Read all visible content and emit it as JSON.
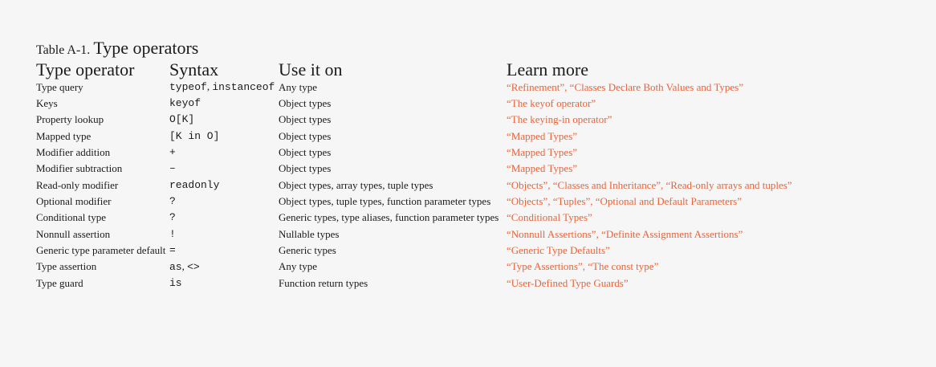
{
  "caption": {
    "label": "Table A-1. ",
    "title": "Type operators"
  },
  "columns": {
    "operator": "Type operator",
    "syntax": "Syntax",
    "use_on": "Use it on",
    "learn_more": "Learn more"
  },
  "rows": [
    {
      "operator": "Type query",
      "syntax": [
        {
          "text": "typeof",
          "code": true
        },
        {
          "text": ", ",
          "code": false
        },
        {
          "text": "instanceof",
          "code": true
        }
      ],
      "use_on": "Any type",
      "learn_more": "“Refinement”, “Classes Declare Both Values and Types”"
    },
    {
      "operator": "Keys",
      "syntax": [
        {
          "text": "keyof",
          "code": true
        }
      ],
      "use_on": "Object types",
      "learn_more": "“The keyof operator”"
    },
    {
      "operator": "Property lookup",
      "syntax": [
        {
          "text": "O[K]",
          "code": true
        }
      ],
      "use_on": "Object types",
      "learn_more": "“The keying-in operator”"
    },
    {
      "operator": "Mapped type",
      "syntax": [
        {
          "text": "[K in O]",
          "code": true
        }
      ],
      "use_on": "Object types",
      "learn_more": "“Mapped Types”"
    },
    {
      "operator": "Modifier addition",
      "syntax": [
        {
          "text": "+",
          "code": true
        }
      ],
      "use_on": "Object types",
      "learn_more": "“Mapped Types”"
    },
    {
      "operator": "Modifier subtraction",
      "syntax": [
        {
          "text": "–",
          "code": true
        }
      ],
      "use_on": "Object types",
      "learn_more": "“Mapped Types”"
    },
    {
      "operator": "Read-only modifier",
      "syntax": [
        {
          "text": "readonly",
          "code": true
        }
      ],
      "use_on": "Object types, array types, tuple types",
      "learn_more": "“Objects”, “Classes and Inheritance”, “Read-only arrays and tuples”"
    },
    {
      "operator": "Optional modifier",
      "syntax": [
        {
          "text": "?",
          "code": true
        }
      ],
      "use_on": "Object types, tuple types, function parameter types",
      "learn_more": "“Objects”, “Tuples”, “Optional and Default Parameters”"
    },
    {
      "operator": "Conditional type",
      "syntax": [
        {
          "text": "?",
          "code": true
        }
      ],
      "use_on": "Generic types, type aliases, function parameter types",
      "learn_more": "“Conditional Types”"
    },
    {
      "operator": "Nonnull assertion",
      "syntax": [
        {
          "text": "!",
          "code": true
        }
      ],
      "use_on": "Nullable types",
      "learn_more": "“Nonnull Assertions”, “Definite Assignment Assertions”"
    },
    {
      "operator": "Generic type parameter default",
      "syntax": [
        {
          "text": "=",
          "code": true
        }
      ],
      "use_on": "Generic types",
      "learn_more": "“Generic Type Defaults”"
    },
    {
      "operator": "Type assertion",
      "syntax": [
        {
          "text": "as",
          "code": true
        },
        {
          "text": ", ",
          "code": false
        },
        {
          "text": "<>",
          "code": true
        }
      ],
      "use_on": "Any type",
      "learn_more": "“Type Assertions”, “The const type”"
    },
    {
      "operator": "Type guard",
      "syntax": [
        {
          "text": "is",
          "code": true
        }
      ],
      "use_on": "Function return types",
      "learn_more": "“User-Defined Type Guards”"
    }
  ],
  "colors": {
    "link": "#e8643a",
    "text": "#1a1a1a",
    "background": "#f6f6f6"
  }
}
